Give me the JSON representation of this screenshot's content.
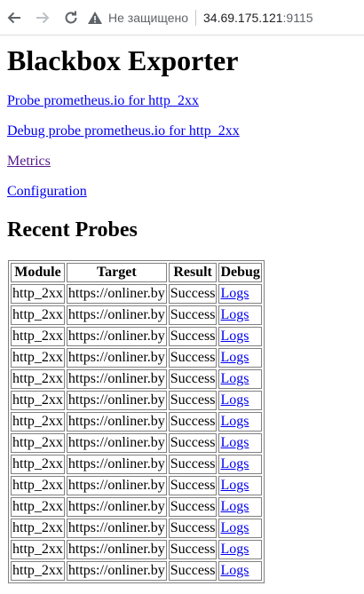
{
  "browser": {
    "security_label": "Не защищено",
    "host": "34.69.175.121",
    "port": ":9115"
  },
  "page": {
    "title": "Blackbox Exporter",
    "links": [
      {
        "label": "Probe prometheus.io for http_2xx",
        "visited": false
      },
      {
        "label": "Debug probe prometheus.io for http_2xx",
        "visited": false
      },
      {
        "label": "Metrics",
        "visited": true
      },
      {
        "label": "Configuration",
        "visited": false
      }
    ],
    "recent_probes_heading": "Recent Probes",
    "table": {
      "headers": [
        "Module",
        "Target",
        "Result",
        "Debug"
      ],
      "rows": [
        [
          "http_2xx",
          "https://onliner.by",
          "Success",
          "Logs"
        ],
        [
          "http_2xx",
          "https://onliner.by",
          "Success",
          "Logs"
        ],
        [
          "http_2xx",
          "https://onliner.by",
          "Success",
          "Logs"
        ],
        [
          "http_2xx",
          "https://onliner.by",
          "Success",
          "Logs"
        ],
        [
          "http_2xx",
          "https://onliner.by",
          "Success",
          "Logs"
        ],
        [
          "http_2xx",
          "https://onliner.by",
          "Success",
          "Logs"
        ],
        [
          "http_2xx",
          "https://onliner.by",
          "Success",
          "Logs"
        ],
        [
          "http_2xx",
          "https://onliner.by",
          "Success",
          "Logs"
        ],
        [
          "http_2xx",
          "https://onliner.by",
          "Success",
          "Logs"
        ],
        [
          "http_2xx",
          "https://onliner.by",
          "Success",
          "Logs"
        ],
        [
          "http_2xx",
          "https://onliner.by",
          "Success",
          "Logs"
        ],
        [
          "http_2xx",
          "https://onliner.by",
          "Success",
          "Logs"
        ],
        [
          "http_2xx",
          "https://onliner.by",
          "Success",
          "Logs"
        ],
        [
          "http_2xx",
          "https://onliner.by",
          "Success",
          "Logs"
        ]
      ]
    }
  }
}
